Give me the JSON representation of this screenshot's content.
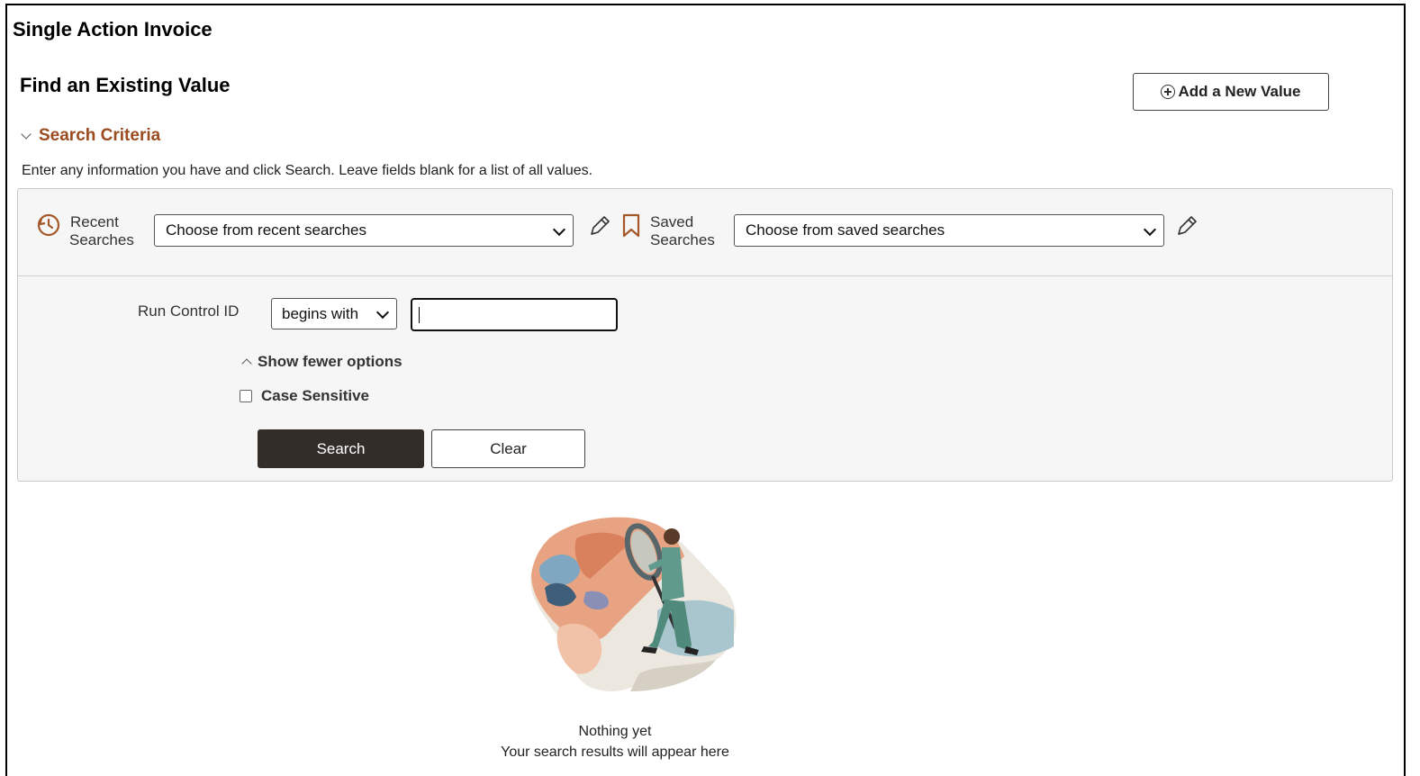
{
  "page": {
    "title": "Single Action Invoice",
    "section_title": "Find an Existing Value"
  },
  "add_button": {
    "label": "Add a New Value",
    "icon": "plus-circle-icon"
  },
  "search_criteria": {
    "toggle_label": "Search Criteria",
    "instructions": "Enter any information you have and click Search. Leave fields blank for a list of all values."
  },
  "recent_searches": {
    "label_line1": "Recent",
    "label_line2": "Searches",
    "selected": "Choose from recent searches",
    "icon": "history-icon"
  },
  "saved_searches": {
    "label_line1": "Saved",
    "label_line2": "Searches",
    "selected": "Choose from saved searches",
    "icon": "bookmark-icon"
  },
  "run_control": {
    "label": "Run Control ID",
    "operator": "begins with",
    "value": ""
  },
  "options": {
    "fewer_label": "Show fewer options",
    "case_sensitive_label": "Case Sensitive",
    "case_sensitive_checked": false
  },
  "actions": {
    "search_label": "Search",
    "clear_label": "Clear"
  },
  "results": {
    "empty_title": "Nothing yet",
    "empty_subtitle": "Your search results will appear here",
    "illustration": "person-with-magnifying-glass"
  },
  "colors": {
    "accent_link": "#9a4b1f",
    "primary_button": "#332d29",
    "panel_bg": "#f6f6f6"
  }
}
